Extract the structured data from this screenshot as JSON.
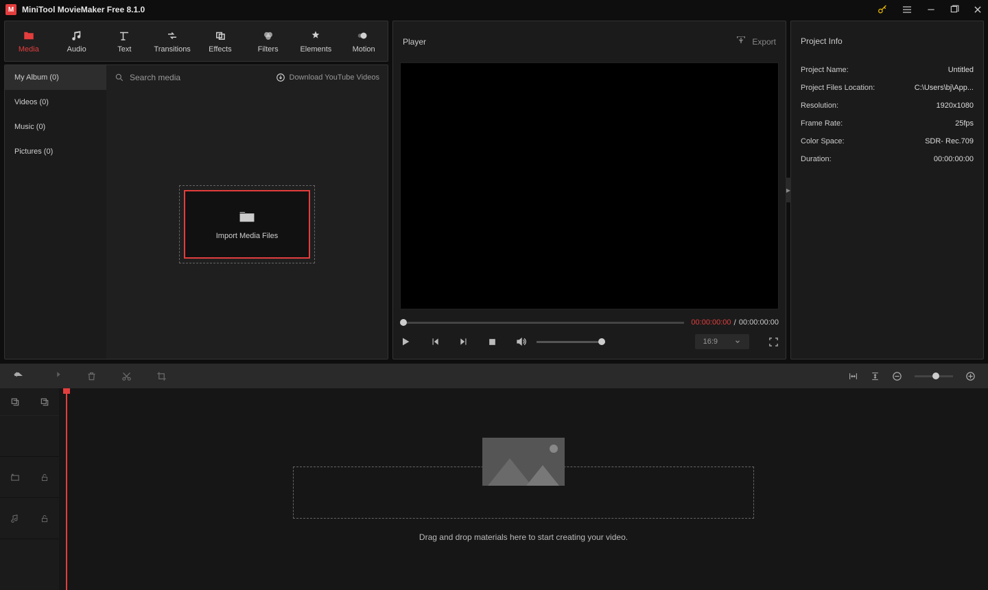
{
  "titlebar": {
    "app_name": "MiniTool MovieMaker Free 8.1.0"
  },
  "toolbar": {
    "items": [
      {
        "label": "Media"
      },
      {
        "label": "Audio"
      },
      {
        "label": "Text"
      },
      {
        "label": "Transitions"
      },
      {
        "label": "Effects"
      },
      {
        "label": "Filters"
      },
      {
        "label": "Elements"
      },
      {
        "label": "Motion"
      }
    ]
  },
  "album": {
    "items": [
      {
        "label": "My Album (0)"
      },
      {
        "label": "Videos (0)"
      },
      {
        "label": "Music (0)"
      },
      {
        "label": "Pictures (0)"
      }
    ],
    "search_placeholder": "Search media",
    "download_label": "Download YouTube Videos",
    "import_label": "Import Media Files"
  },
  "player": {
    "title": "Player",
    "export_label": "Export",
    "time_current": "00:00:00:00",
    "time_sep": " / ",
    "time_total": "00:00:00:00",
    "ratio": "16:9"
  },
  "info": {
    "title": "Project Info",
    "rows": [
      {
        "label": "Project Name:",
        "value": "Untitled"
      },
      {
        "label": "Project Files Location:",
        "value": "C:\\Users\\bj\\App..."
      },
      {
        "label": "Resolution:",
        "value": "1920x1080"
      },
      {
        "label": "Frame Rate:",
        "value": "25fps"
      },
      {
        "label": "Color Space:",
        "value": "SDR- Rec.709"
      },
      {
        "label": "Duration:",
        "value": "00:00:00:00"
      }
    ]
  },
  "timeline": {
    "drop_text": "Drag and drop materials here to start creating your video."
  }
}
